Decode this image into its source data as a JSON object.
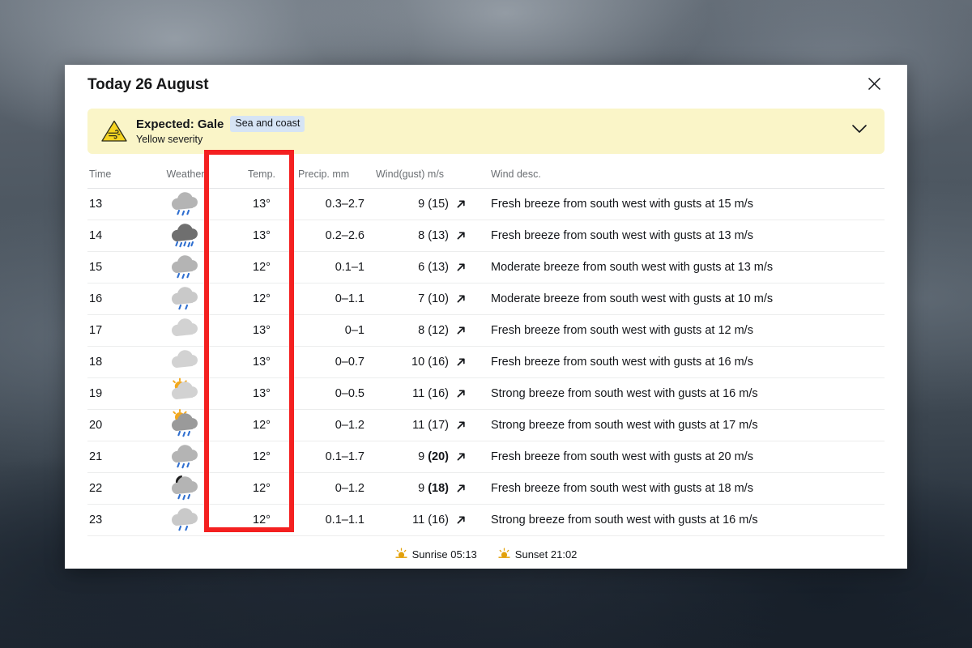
{
  "header": {
    "title": "Today 26 August",
    "close_icon": "close-icon"
  },
  "warning": {
    "icon": "wind-warning-triangle-icon",
    "title": "Expected: Gale",
    "badge": "Sea and coast",
    "severity": "Yellow severity",
    "expand_icon": "chevron-down-icon",
    "bg_color": "#faf5c8",
    "badge_color": "#d6e4f5"
  },
  "table": {
    "columns": [
      "Time",
      "Weather",
      "Temp.",
      "Precip. mm",
      "Wind(gust) m/s",
      "Wind desc."
    ],
    "rows": [
      {
        "time": "13",
        "weather_icon": "cloud-rain-icon",
        "temp": "13°",
        "precip": "0.3–2.7",
        "wind": "9",
        "gust": "15",
        "gust_bold": false,
        "wind_dir_icon": "arrow-north-east-icon",
        "desc": "Fresh breeze from south west with gusts at 15 m/s"
      },
      {
        "time": "14",
        "weather_icon": "cloud-heavy-rain-icon",
        "temp": "13°",
        "precip": "0.2–2.6",
        "wind": "8",
        "gust": "13",
        "gust_bold": false,
        "wind_dir_icon": "arrow-north-east-icon",
        "desc": "Fresh breeze from south west with gusts at 13 m/s"
      },
      {
        "time": "15",
        "weather_icon": "cloud-rain-icon",
        "temp": "12°",
        "precip": "0.1–1",
        "wind": "6",
        "gust": "13",
        "gust_bold": false,
        "wind_dir_icon": "arrow-north-east-icon",
        "desc": "Moderate breeze from south west with gusts at 13 m/s"
      },
      {
        "time": "16",
        "weather_icon": "cloud-light-rain-icon",
        "temp": "12°",
        "precip": "0–1.1",
        "wind": "7",
        "gust": "10",
        "gust_bold": false,
        "wind_dir_icon": "arrow-north-east-icon",
        "desc": "Moderate breeze from south west with gusts at 10 m/s"
      },
      {
        "time": "17",
        "weather_icon": "cloud-icon",
        "temp": "13°",
        "precip": "0–1",
        "wind": "8",
        "gust": "12",
        "gust_bold": false,
        "wind_dir_icon": "arrow-north-east-icon",
        "desc": "Fresh breeze from south west with gusts at 12 m/s"
      },
      {
        "time": "18",
        "weather_icon": "cloud-icon",
        "temp": "13°",
        "precip": "0–0.7",
        "wind": "10",
        "gust": "16",
        "gust_bold": false,
        "wind_dir_icon": "arrow-north-east-icon",
        "desc": "Fresh breeze from south west with gusts at 16 m/s"
      },
      {
        "time": "19",
        "weather_icon": "sun-cloud-icon",
        "temp": "13°",
        "precip": "0–0.5",
        "wind": "11",
        "gust": "16",
        "gust_bold": false,
        "wind_dir_icon": "arrow-north-east-icon",
        "desc": "Strong breeze from south west with gusts at 16 m/s"
      },
      {
        "time": "20",
        "weather_icon": "sun-cloud-rain-icon",
        "temp": "12°",
        "precip": "0–1.2",
        "wind": "11",
        "gust": "17",
        "gust_bold": false,
        "wind_dir_icon": "arrow-north-east-icon",
        "desc": "Strong breeze from south west with gusts at 17 m/s"
      },
      {
        "time": "21",
        "weather_icon": "cloud-rain-icon",
        "temp": "12°",
        "precip": "0.1–1.7",
        "wind": "9",
        "gust": "20",
        "gust_bold": true,
        "wind_dir_icon": "arrow-north-east-icon",
        "desc": "Fresh breeze from south west with gusts at 20 m/s"
      },
      {
        "time": "22",
        "weather_icon": "moon-cloud-rain-icon",
        "temp": "12°",
        "precip": "0–1.2",
        "wind": "9",
        "gust": "18",
        "gust_bold": true,
        "wind_dir_icon": "arrow-north-east-icon",
        "desc": "Fresh breeze from south west with gusts at 18 m/s"
      },
      {
        "time": "23",
        "weather_icon": "cloud-light-rain-icon",
        "temp": "12°",
        "precip": "0.1–1.1",
        "wind": "11",
        "gust": "16",
        "gust_bold": false,
        "wind_dir_icon": "arrow-north-east-icon",
        "desc": "Strong breeze from south west with gusts at 16 m/s"
      }
    ]
  },
  "footer": {
    "sunrise_icon": "sunrise-icon",
    "sunrise": "Sunrise 05:13",
    "sunset_icon": "sunset-icon",
    "sunset": "Sunset 21:02"
  },
  "annotation": {
    "highlight_target": "temp-column",
    "highlight_color": "#f42020"
  },
  "colors": {
    "temp_text": "#b3261e",
    "precip_text": "#2a6ebb"
  }
}
